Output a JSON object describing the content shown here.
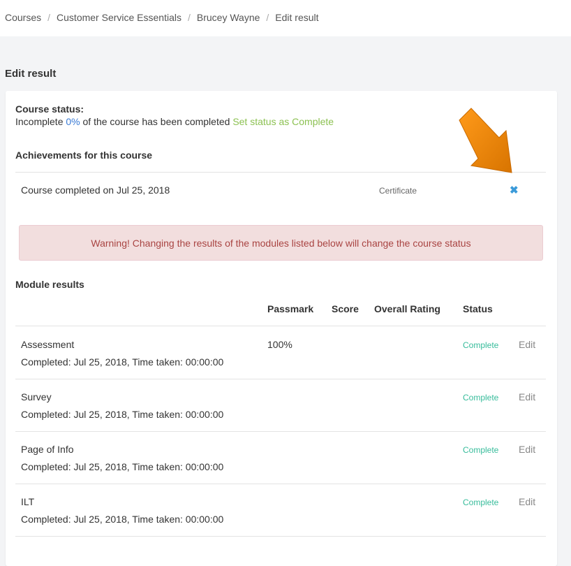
{
  "breadcrumb": {
    "items": [
      "Courses",
      "Customer Service Essentials",
      "Brucey Wayne",
      "Edit result"
    ],
    "separator": "/"
  },
  "page": {
    "title": "Edit result"
  },
  "course_status": {
    "label": "Course status:",
    "state": "Incomplete",
    "percent": "0%",
    "suffix": "of the course has been completed",
    "action": "Set status as Complete"
  },
  "achievements": {
    "heading": "Achievements for this course",
    "items": [
      {
        "text": "Course completed on Jul 25, 2018",
        "type": "Certificate",
        "remove_icon": "close-icon"
      }
    ]
  },
  "warning": {
    "text": "Warning! Changing the results of the modules listed below will change the course status"
  },
  "modules": {
    "heading": "Module results",
    "columns": [
      "Passmark",
      "Score",
      "Overall Rating",
      "Status"
    ],
    "rows": [
      {
        "name": "Assessment",
        "meta": "Completed: Jul 25, 2018, Time taken: 00:00:00",
        "passmark": "100%",
        "status": "Complete",
        "edit": "Edit"
      },
      {
        "name": "Survey",
        "meta": "Completed: Jul 25, 2018, Time taken: 00:00:00",
        "passmark": "",
        "status": "Complete",
        "edit": "Edit"
      },
      {
        "name": "Page of Info",
        "meta": "Completed: Jul 25, 2018, Time taken: 00:00:00",
        "passmark": "",
        "status": "Complete",
        "edit": "Edit"
      },
      {
        "name": "ILT",
        "meta": "Completed: Jul 25, 2018, Time taken: 00:00:00",
        "passmark": "",
        "status": "Complete",
        "edit": "Edit"
      }
    ]
  },
  "colors": {
    "accent_blue": "#3a7bd5",
    "set_complete_green": "#8cc152",
    "status_green": "#37bc9b",
    "warning_bg": "#f2dede",
    "warning_text": "#a94442",
    "arrow_orange": "#f08a00"
  }
}
